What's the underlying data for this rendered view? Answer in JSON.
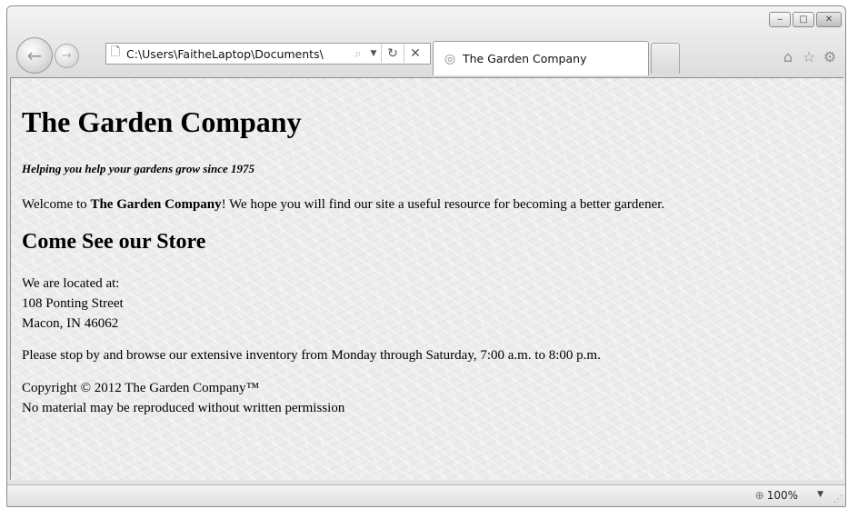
{
  "browser": {
    "address": {
      "url": "C:\\Users\\FaitheLaptop\\Documents\\"
    },
    "tab": {
      "title": "The Garden Company"
    },
    "icons": {
      "page": "page-icon",
      "search": "search-icon",
      "dropdown": "dropdown-icon",
      "refresh": "refresh-icon",
      "stop": "stop-icon",
      "home": "home-icon",
      "favorites": "star-icon",
      "tools": "gear-icon",
      "minimize": "minimize-icon",
      "maximize": "maximize-icon",
      "close": "close-icon",
      "back": "back-arrow-icon",
      "forward": "forward-arrow-icon"
    },
    "status": {
      "zoom": "100%"
    }
  },
  "page": {
    "title": "The Garden Company",
    "tagline": "Helping you help your gardens grow since 1975",
    "welcome": {
      "before": "Welcome to ",
      "company": "The Garden Company",
      "after": "! We hope you will find our site a useful resource for becoming a better gardener."
    },
    "store_heading": "Come See our Store",
    "address": {
      "intro": "We are located at:",
      "street": "108 Ponting Street",
      "city": "Macon, IN 46062"
    },
    "hours": "Please stop by and browse our extensive inventory from Monday through Saturday, 7:00 a.m. to 8:00 p.m.",
    "footer": {
      "copyright": "Copyright © 2012 The Garden Company™",
      "notice": "No material may be reproduced without written permission"
    }
  }
}
